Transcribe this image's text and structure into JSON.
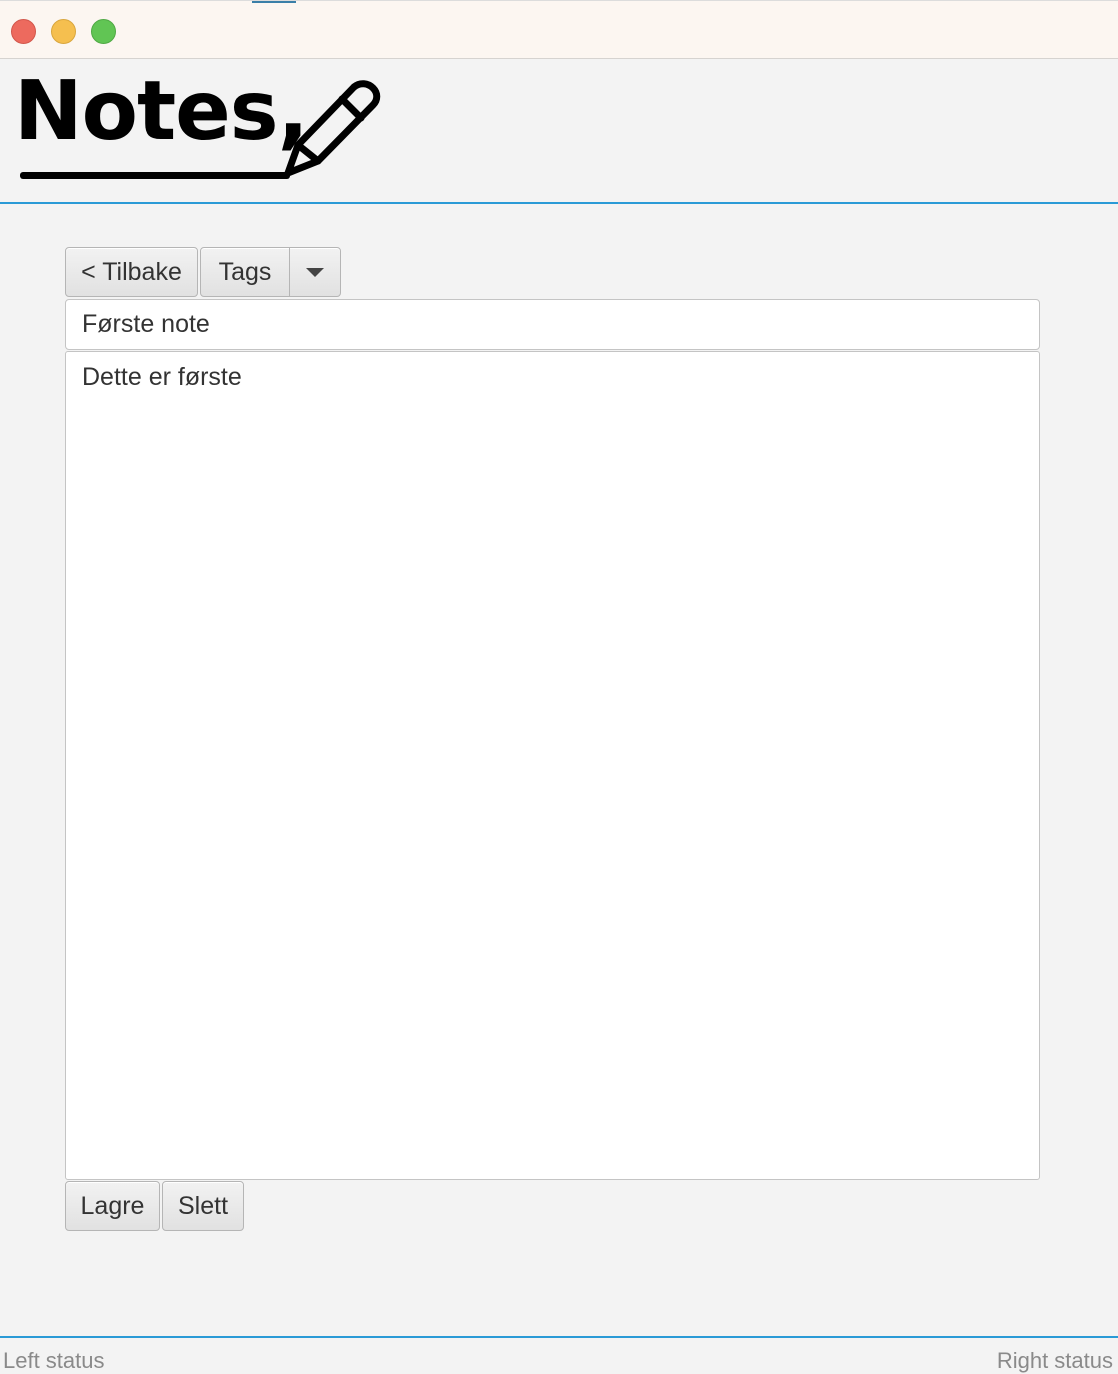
{
  "window": {
    "traffic_lights": [
      "close",
      "minimize",
      "zoom"
    ],
    "colors": {
      "close": "#ed6a5e",
      "minimize": "#f5bf4f",
      "zoom": "#61c554"
    }
  },
  "header": {
    "logo_text": "Notes,",
    "logo_icon": "pencil-icon",
    "accent_color": "#2a9ad6"
  },
  "toolbar": {
    "back_label": "< Tilbake",
    "tags_label": "Tags",
    "tags_dropdown_icon": "chevron-down-icon"
  },
  "note": {
    "title_value": "Første note",
    "body_value": "Dette er første"
  },
  "actions": {
    "save_label": "Lagre",
    "delete_label": "Slett"
  },
  "status": {
    "left": "Left status",
    "right": "Right status"
  }
}
